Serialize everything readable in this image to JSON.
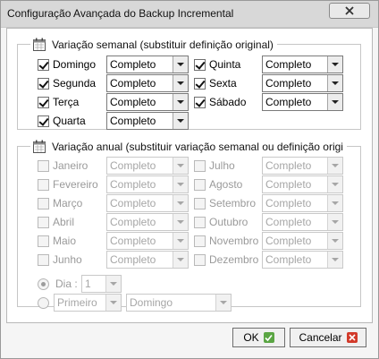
{
  "window": {
    "title": "Configuração Avançada do Backup Incremental"
  },
  "weekly": {
    "legend": "Variação semanal (substituir definição original)",
    "days": [
      {
        "label": "Domingo",
        "checked": true,
        "value": "Completo"
      },
      {
        "label": "Segunda",
        "checked": true,
        "value": "Completo"
      },
      {
        "label": "Terça",
        "checked": true,
        "value": "Completo"
      },
      {
        "label": "Quarta",
        "checked": true,
        "value": "Completo"
      },
      {
        "label": "Quinta",
        "checked": true,
        "value": "Completo"
      },
      {
        "label": "Sexta",
        "checked": true,
        "value": "Completo"
      },
      {
        "label": "Sábado",
        "checked": true,
        "value": "Completo"
      }
    ]
  },
  "annual": {
    "legend": "Variação anual (substituir variação semanal ou definição origi",
    "months": [
      {
        "label": "Janeiro",
        "checked": false,
        "value": "Completo"
      },
      {
        "label": "Fevereiro",
        "checked": false,
        "value": "Completo"
      },
      {
        "label": "Março",
        "checked": false,
        "value": "Completo"
      },
      {
        "label": "Abril",
        "checked": false,
        "value": "Completo"
      },
      {
        "label": "Maio",
        "checked": false,
        "value": "Completo"
      },
      {
        "label": "Junho",
        "checked": false,
        "value": "Completo"
      },
      {
        "label": "Julho",
        "checked": false,
        "value": "Completo"
      },
      {
        "label": "Agosto",
        "checked": false,
        "value": "Completo"
      },
      {
        "label": "Setembro",
        "checked": false,
        "value": "Completo"
      },
      {
        "label": "Outubro",
        "checked": false,
        "value": "Completo"
      },
      {
        "label": "Novembro",
        "checked": false,
        "value": "Completo"
      },
      {
        "label": "Dezembro",
        "checked": false,
        "value": "Completo"
      }
    ],
    "day_option": {
      "label": "Dia :",
      "value": "1",
      "selected": true
    },
    "ordinal_option": {
      "ordinal": "Primeiro",
      "weekday": "Domingo",
      "selected": false
    }
  },
  "buttons": {
    "ok": "OK",
    "cancel": "Cancelar"
  },
  "icons": {
    "close": "close-icon",
    "ok": "checkmark-icon",
    "cancel": "cancel-x-icon",
    "calendar": "calendar-icon"
  },
  "colors": {
    "ok_icon": "#5aa543",
    "cancel_icon": "#d23a2a"
  }
}
